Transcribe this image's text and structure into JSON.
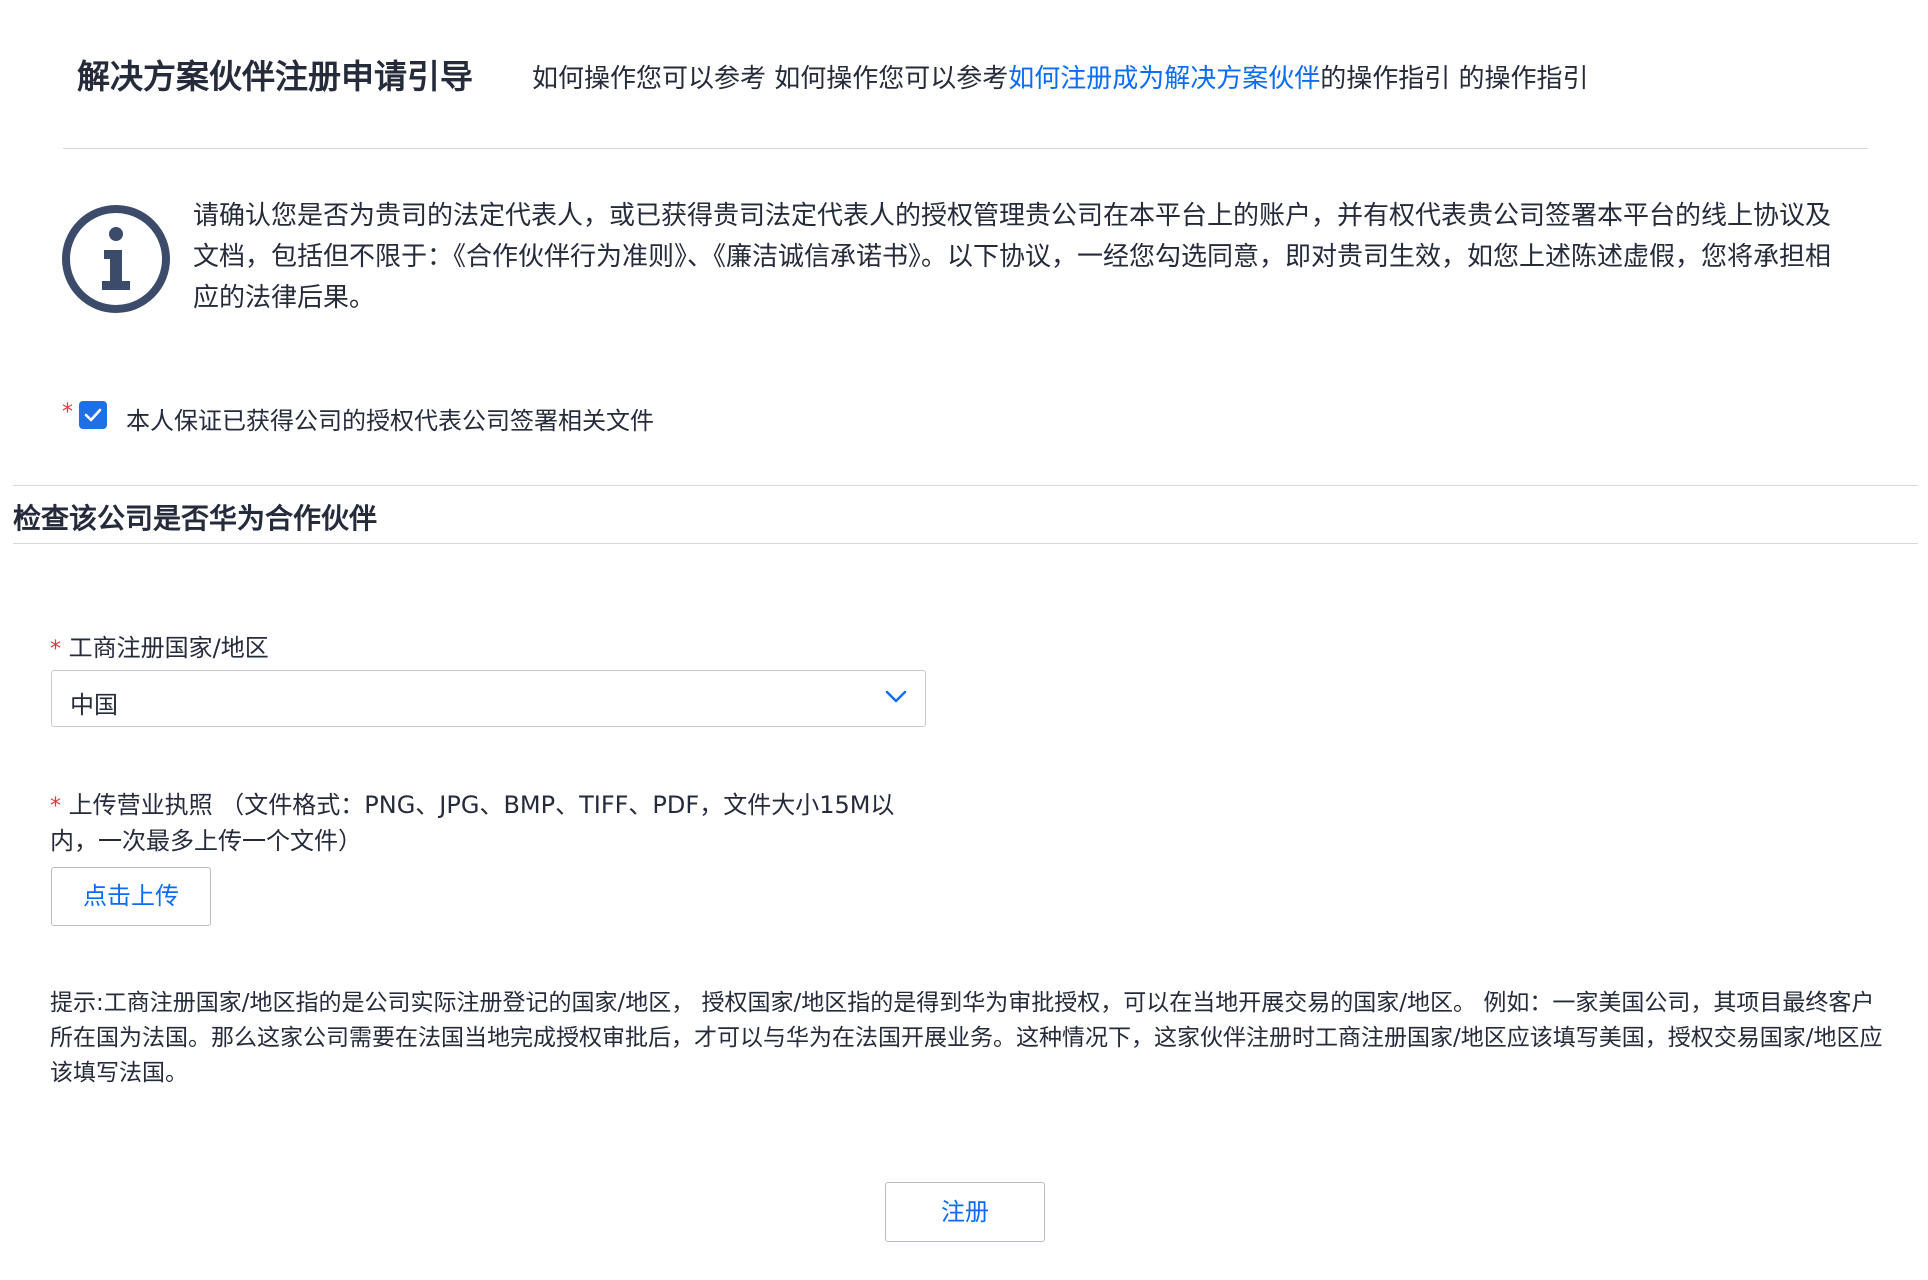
{
  "header": {
    "title": "解决方案伙伴注册申请引导",
    "guide_prefix": "如何操作您可以参考 如何操作您可以参考",
    "guide_link": "如何注册成为解决方案伙伴",
    "guide_suffix": "的操作指引 的操作指引"
  },
  "notice": {
    "icon": "info-circle-icon",
    "text": "请确认您是否为贵司的法定代表人，或已获得贵司法定代表人的授权管理贵公司在本平台上的账户，并有权代表贵公司签署本平台的线上协议及文档，包括但不限于：《合作伙伴行为准则》、《廉洁诚信承诺书》。以下协议，一经您勾选同意，即对贵司生效，如您上述陈述虚假，您将承担相应的法律后果。"
  },
  "authorization": {
    "required_mark": "*",
    "checked": true,
    "label": "本人保证已获得公司的授权代表公司签署相关文件"
  },
  "section": {
    "title": "检查该公司是否华为合作伙伴"
  },
  "country": {
    "required_mark": "*",
    "label": "工商注册国家/地区",
    "value": "中国"
  },
  "upload": {
    "required_mark": "*",
    "label": "上传营业执照 （文件格式：PNG、JPG、BMP、TIFF、PDF，文件大小15M以内，一次最多上传一个文件）",
    "button_label": "点击上传"
  },
  "hint": {
    "text": "提示:工商注册国家/地区指的是公司实际注册登记的国家/地区， 授权国家/地区指的是得到华为审批授权，可以在当地开展交易的国家/地区。 例如：一家美国公司，其项目最终客户所在国为法国。那么这家公司需要在法国当地完成授权审批后，才可以与华为在法国开展业务。这种情况下，这家伙伴注册时工商注册国家/地区应该填写美国，授权交易国家/地区应该填写法国。"
  },
  "register": {
    "label": "注册"
  },
  "colors": {
    "accent": "#0a6cf5",
    "required": "#e4393c",
    "checkbox": "#1f6fe5",
    "icon": "#3d4b6b"
  }
}
